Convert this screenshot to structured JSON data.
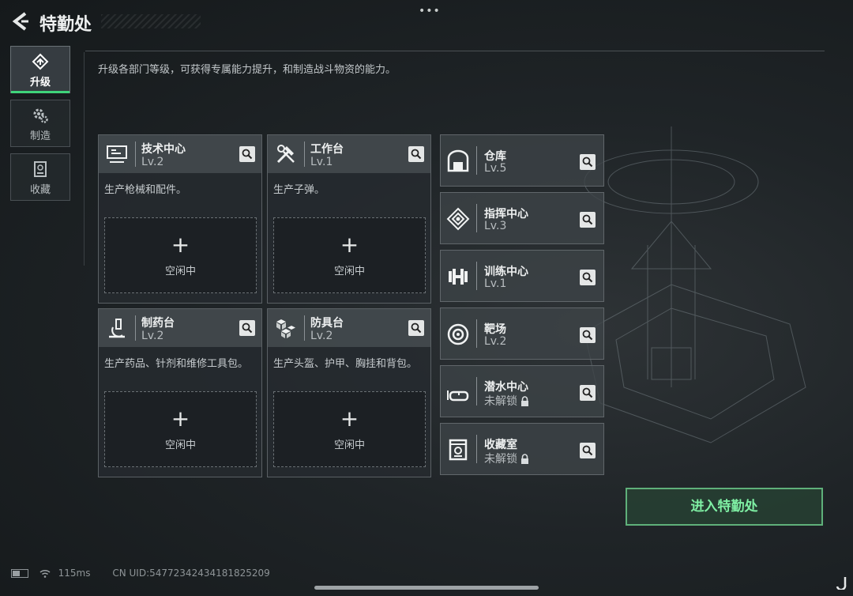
{
  "header": {
    "title": "特勤处",
    "menu_dots": "•••"
  },
  "sidebar": {
    "tabs": [
      {
        "label": "升级",
        "icon": "upgrade-icon",
        "active": true
      },
      {
        "label": "制造",
        "icon": "gear-icon",
        "active": false
      },
      {
        "label": "收藏",
        "icon": "collection-icon",
        "active": false
      }
    ]
  },
  "main": {
    "description": "升级各部门等级，可获得专属能力提升，和制造战斗物资的能力。",
    "workshops": [
      {
        "name": "技术中心",
        "level": "Lv.2",
        "desc": "生产枪械和配件。",
        "slot_plus": "+",
        "slot_status": "空闲中",
        "icon": "computer-icon"
      },
      {
        "name": "工作台",
        "level": "Lv.1",
        "desc": "生产子弹。",
        "slot_plus": "+",
        "slot_status": "空闲中",
        "icon": "tools-icon"
      },
      {
        "name": "制药台",
        "level": "Lv.2",
        "desc": "生产药品、针剂和维修工具包。",
        "slot_plus": "+",
        "slot_status": "空闲中",
        "icon": "microscope-icon"
      },
      {
        "name": "防具台",
        "level": "Lv.2",
        "desc": "生产头盔、护甲、胸挂和背包。",
        "slot_plus": "+",
        "slot_status": "空闲中",
        "icon": "armor-boxes-icon"
      }
    ],
    "facilities": [
      {
        "name": "仓库",
        "level": "Lv.5",
        "icon": "warehouse-icon"
      },
      {
        "name": "指挥中心",
        "level": "Lv.3",
        "icon": "command-center-icon"
      },
      {
        "name": "训练中心",
        "level": "Lv.1",
        "icon": "dumbbell-icon"
      },
      {
        "name": "靶场",
        "level": "Lv.2",
        "icon": "target-icon"
      },
      {
        "name": "潜水中心",
        "level": "未解锁",
        "icon": "diving-mask-icon",
        "locked": true
      },
      {
        "name": "收藏室",
        "level": "未解锁",
        "icon": "collection-room-icon",
        "locked": true
      }
    ],
    "enter_button": "进入特勤处"
  },
  "status_bar": {
    "ping": "115ms",
    "uid": "CN UID:5477234243418182​5209"
  },
  "colors": {
    "accent_green": "#3fd47a",
    "button_text": "#7ff0a4"
  }
}
